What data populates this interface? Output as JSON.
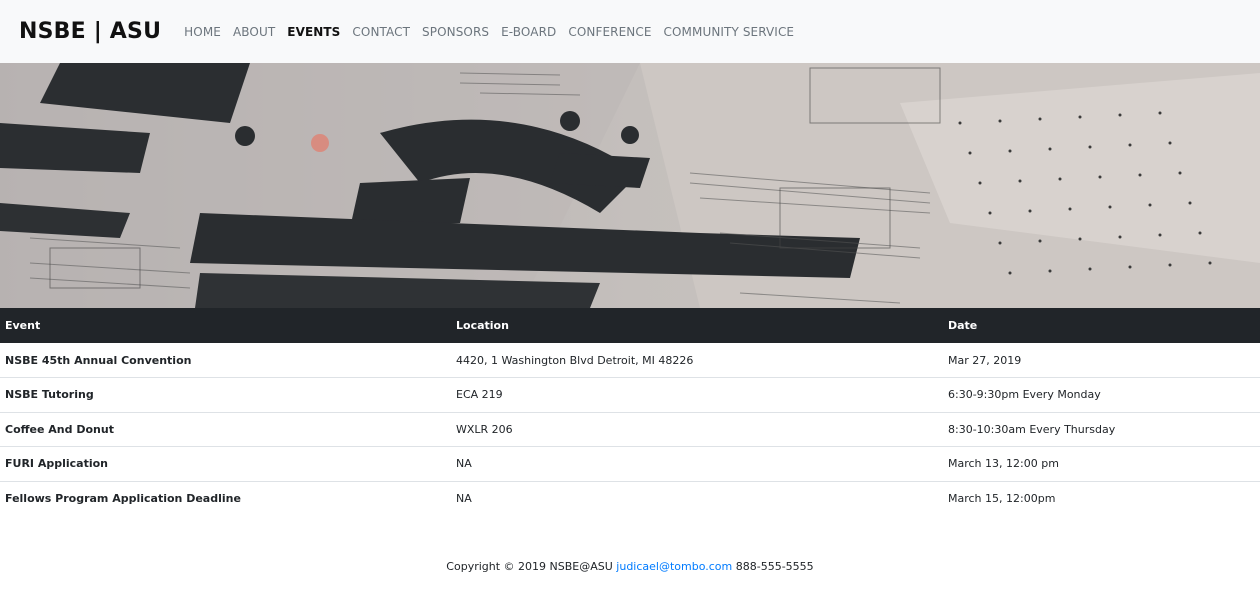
{
  "nav": {
    "brand": "NSBE | ASU",
    "links": [
      "HOME",
      "ABOUT",
      "EVENTS",
      "CONTACT",
      "SPONSORS",
      "E-BOARD",
      "CONFERENCE",
      "COMMUNITY SERVICE"
    ],
    "active": "EVENTS"
  },
  "hero": {
    "image": "newspaper-photo"
  },
  "table": {
    "headers": [
      "Event",
      "Location",
      "Date"
    ],
    "rows": [
      [
        "NSBE 45th Annual Convention",
        "4420, 1 Washington Blvd Detroit, MI 48226",
        "Mar 27, 2019"
      ],
      [
        "NSBE Tutoring",
        "ECA 219",
        "6:30-9:30pm Every Monday"
      ],
      [
        "Coffee And Donut",
        "WXLR 206",
        "8:30-10:30am Every Thursday"
      ],
      [
        "FURI Application",
        "NA",
        "March 13, 12:00 pm"
      ],
      [
        "Fellows Program Application Deadline",
        "NA",
        "March 15, 12:00pm"
      ]
    ]
  },
  "footer": {
    "copyright": "Copyright © 2019 NSBE@ASU",
    "email": "judicael@tombo.com",
    "phone": "888-555-5555"
  },
  "colors": {
    "navbar_bg": "#f8f9fa",
    "table_header_bg": "#212529",
    "link": "#007bff"
  }
}
